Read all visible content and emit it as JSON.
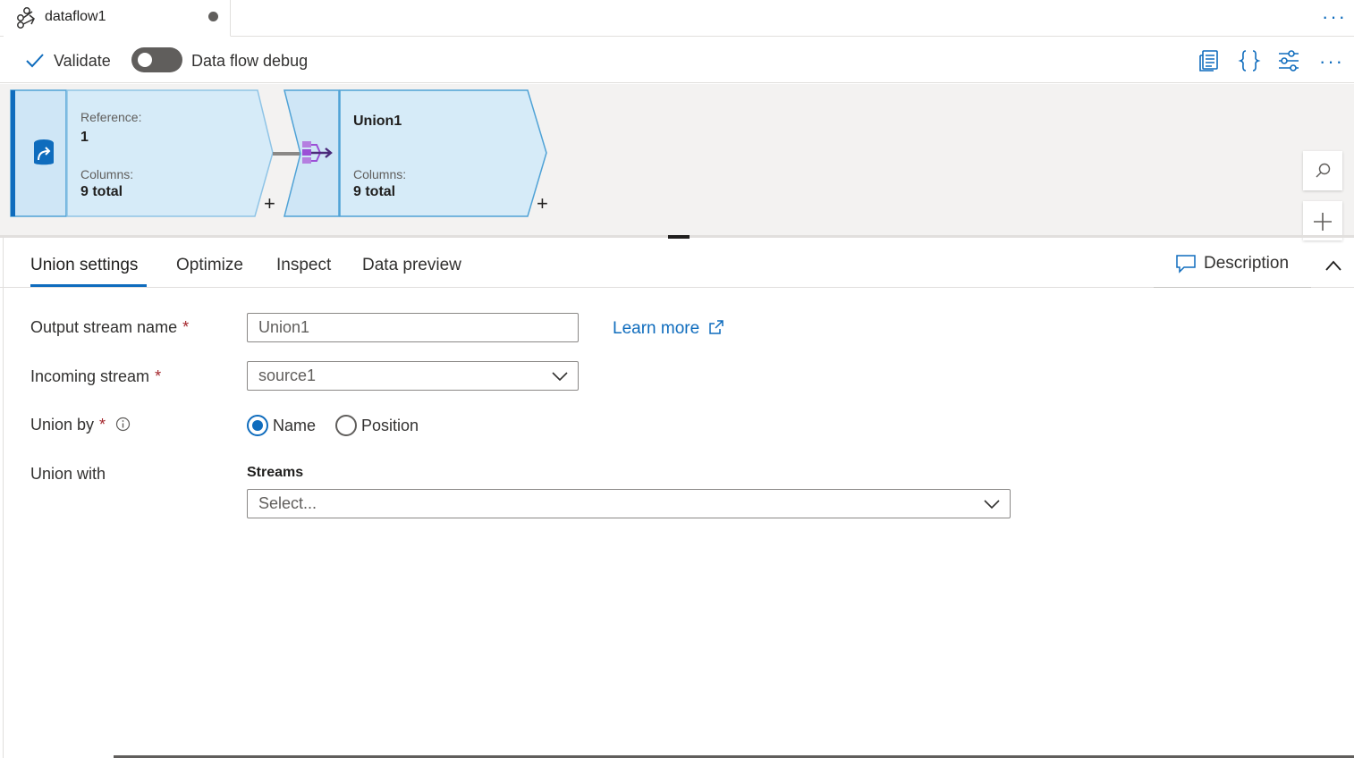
{
  "tab": {
    "title": "dataflow1"
  },
  "toolbar": {
    "validate_label": "Validate",
    "debug_label": "Data flow debug",
    "debug_on": false
  },
  "nodes": [
    {
      "reference_label": "Reference:",
      "reference_value": "1",
      "columns_label": "Columns:",
      "columns_value": "9 total"
    },
    {
      "name": "Union1",
      "columns_label": "Columns:",
      "columns_value": "9 total"
    }
  ],
  "panel": {
    "tabs": [
      {
        "label": "Union settings",
        "active": true
      },
      {
        "label": "Optimize",
        "active": false
      },
      {
        "label": "Inspect",
        "active": false
      },
      {
        "label": "Data preview",
        "active": false
      }
    ],
    "description_label": "Description"
  },
  "form": {
    "output_stream": {
      "label": "Output stream name",
      "required_mark": "*",
      "value": "Union1"
    },
    "learn_more": "Learn more",
    "incoming_stream": {
      "label": "Incoming stream",
      "required_mark": "*",
      "value": "source1"
    },
    "union_by": {
      "label": "Union by",
      "required_mark": "*",
      "options": [
        "Name",
        "Position"
      ],
      "selected": "Name"
    },
    "union_with": {
      "label": "Union with",
      "streams_header": "Streams",
      "placeholder": "Select..."
    }
  },
  "colors": {
    "accent": "#0f6cbd",
    "node_fill": "#d6ebf8",
    "node_border": "#4fa2d6",
    "canvas_bg": "#f3f2f1",
    "required": "#a4262c",
    "union_icon": "#9b4fd6"
  }
}
